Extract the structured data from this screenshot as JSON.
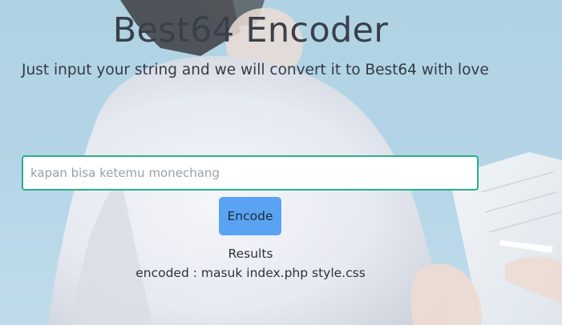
{
  "header": {
    "title": "Best64 Encoder",
    "subtitle": "Just input your string and we will convert it to Best64 with love"
  },
  "form": {
    "input_placeholder": "kapan bisa ketemu monechang",
    "input_value": "",
    "encode_label": "Encode"
  },
  "results": {
    "label": "Results",
    "output": "encoded : masuk index.php style.css"
  },
  "colors": {
    "input_border": "#2bb08a",
    "button_bg": "#5aa3f3",
    "background_sky": "#a6cde1"
  }
}
